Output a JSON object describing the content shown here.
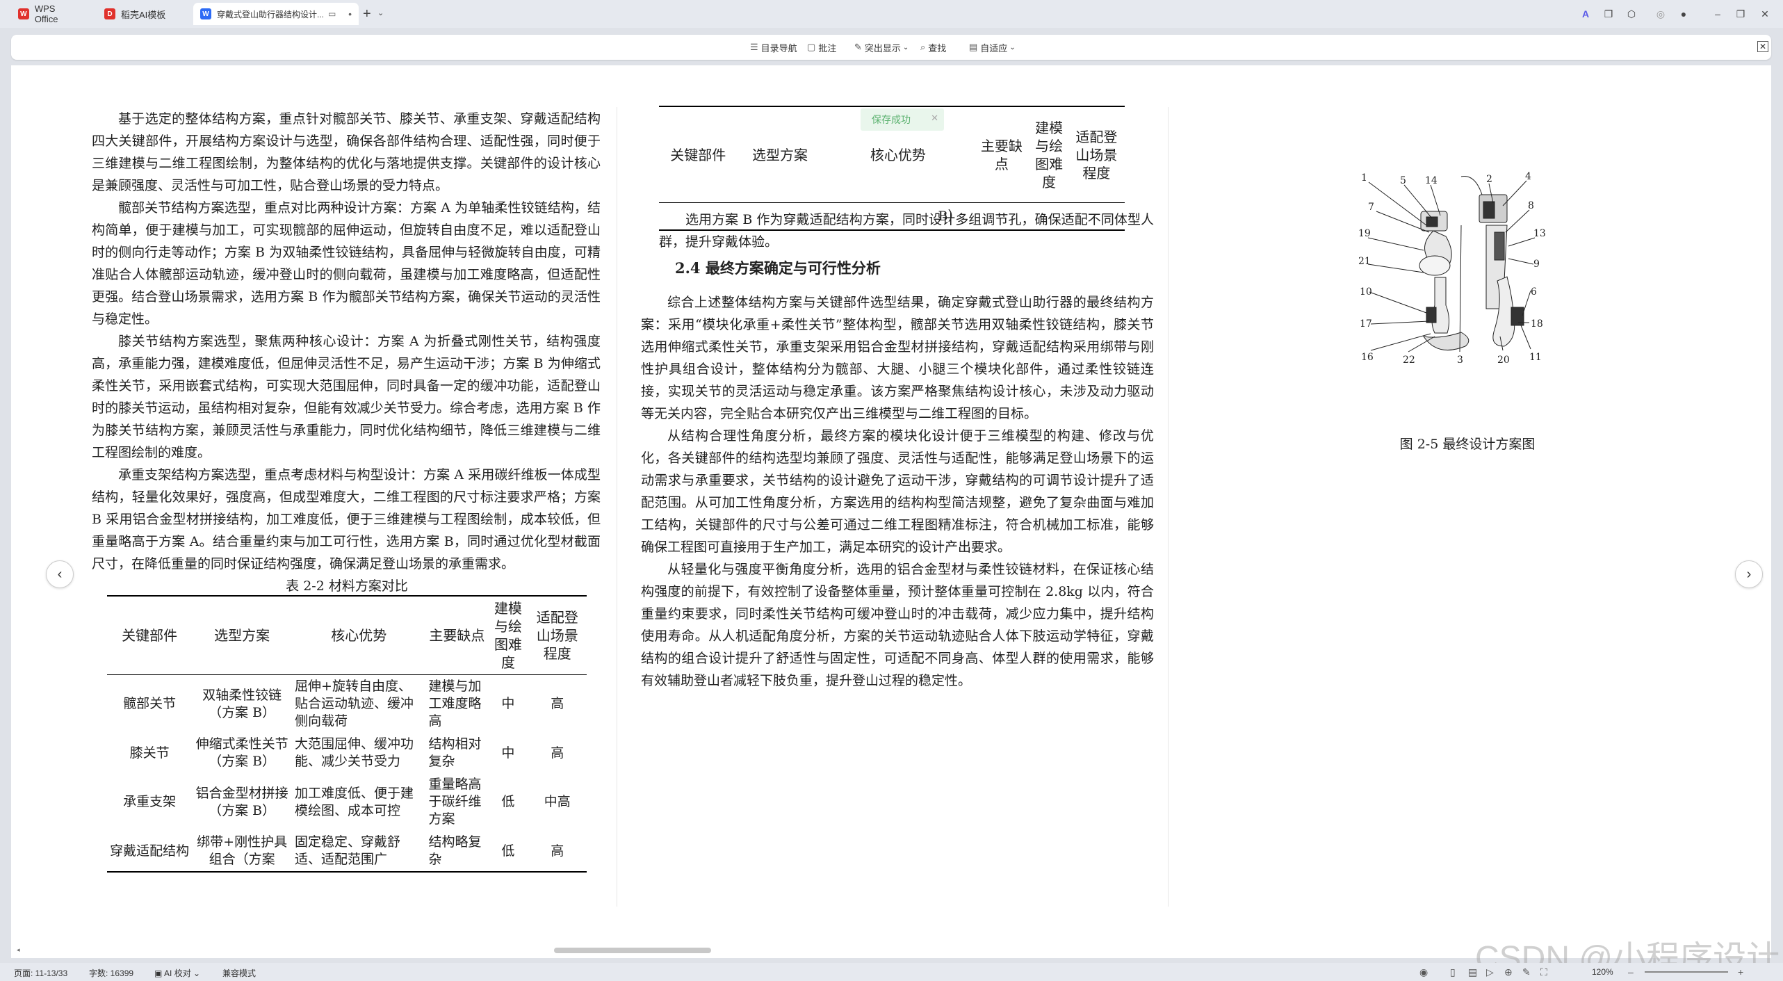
{
  "tabs": [
    {
      "label": "WPS Office",
      "icon": "wps-logo-icon",
      "color": "#e0312c"
    },
    {
      "label": "稻壳AI模板",
      "icon": "docer-logo-icon",
      "color": "#e0312c"
    },
    {
      "label": "穿戴式登山助行器结构设计...",
      "icon": "wps-writer-icon",
      "color": "#2d6bf5"
    }
  ],
  "toolbar": {
    "nav": "目录导航",
    "comment": "批注",
    "highlight": "突出显示",
    "find": "查找",
    "fit": "自适应"
  },
  "document": {
    "left_paragraphs": [
      "基于选定的整体结构方案，重点针对髋部关节、膝关节、承重支架、穿戴适配结构四大关键部件，开展结构方案设计与选型，确保各部件结构合理、适配性强，同时便于三维建模与二维工程图绘制，为整体结构的优化与落地提供支撑。关键部件的设计核心是兼顾强度、灵活性与可加工性，贴合登山场景的受力特点。",
      "髋部关节结构方案选型，重点对比两种设计方案：方案 A 为单轴柔性铰链结构，结构简单，便于建模与加工，可实现髋部的屈伸运动，但旋转自由度不足，难以适配登山时的侧向行走等动作；方案 B 为双轴柔性铰链结构，具备屈伸与轻微旋转自由度，可精准贴合人体髋部运动轨迹，缓冲登山时的侧向载荷，虽建模与加工难度略高，但适配性更强。结合登山场景需求，选用方案 B 作为髋部关节结构方案，确保关节运动的灵活性与稳定性。",
      "膝关节结构方案选型，聚焦两种核心设计：方案 A 为折叠式刚性关节，结构强度高，承重能力强，建模难度低，但屈伸灵活性不足，易产生运动干涉；方案 B 为伸缩式柔性关节，采用嵌套式结构，可实现大范围屈伸，同时具备一定的缓冲功能，适配登山时的膝关节运动，虽结构相对复杂，但能有效减少关节受力。综合考虑，选用方案 B 作为膝关节结构方案，兼顾灵活性与承重能力，同时优化结构细节，降低三维建模与二维工程图绘制的难度。",
      "承重支架结构方案选型，重点考虑材料与构型设计：方案 A 采用碳纤维板一体成型结构，轻量化效果好，强度高，但成型难度大，二维工程图的尺寸标注要求严格；方案 B 采用铝合金型材拼接结构，加工难度低，便于三维建模与工程图绘制，成本较低，但重量略高于方案 A。结合重量约束与加工可行性，选用方案 B，同时通过优化型材截面尺寸，在降低重量的同时保证结构强度，确保满足登山场景的承重需求。"
    ],
    "table1": {
      "caption": "表 2-2  材料方案对比",
      "headers": [
        "关键部件",
        "选型方案",
        "核心优势",
        "主要缺点",
        "建模与绘图难度",
        "适配登山场景程度"
      ],
      "rows": [
        [
          "髋部关节",
          "双轴柔性铰链（方案 B）",
          "屈伸+旋转自由度、贴合运动轨迹、缓冲侧向载荷",
          "建模与加工难度略高",
          "中",
          "高"
        ],
        [
          "膝关节",
          "伸缩式柔性关节（方案 B）",
          "大范围屈伸、缓冲功能、减少关节受力",
          "结构相对复杂",
          "中",
          "高"
        ],
        [
          "承重支架",
          "铝合金型材拼接（方案 B）",
          "加工难度低、便于建模绘图、成本可控",
          "重量略高于碳纤维方案",
          "低",
          "中高"
        ],
        [
          "穿戴适配结构",
          "绑带+刚性护具组合（方案",
          "固定稳定、穿戴舒适、适配范围广",
          "结构略复杂",
          "低",
          "高"
        ]
      ]
    },
    "table2": {
      "headers": [
        "关键部件",
        "选型方案",
        "核心优势",
        "主要缺点",
        "建模与绘图难度",
        "适配登山场景程度"
      ],
      "tail": "B）"
    },
    "mid_para_top": "选用方案 B 作为穿戴适配结构方案，同时设计多组调节孔，确保适配不同体型人群，提升穿戴体验。",
    "section_title": "2.4  最终方案确定与可行性分析",
    "mid_paragraphs": [
      "综合上述整体结构方案与关键部件选型结果，确定穿戴式登山助行器的最终结构方案：采用“模块化承重+柔性关节”整体构型，髋部关节选用双轴柔性铰链结构，膝关节选用伸缩式柔性关节，承重支架采用铝合金型材拼接结构，穿戴适配结构采用绑带与刚性护具组合设计，整体结构分为髋部、大腿、小腿三个模块化部件，通过柔性铰链连接，实现关节的灵活运动与稳定承重。该方案严格聚焦结构设计核心，未涉及动力驱动等无关内容，完全贴合本研究仅产出三维模型与二维工程图的目标。",
      "从结构合理性角度分析，最终方案的模块化设计便于三维模型的构建、修改与优化，各关键部件的结构选型均兼顾了强度、灵活性与适配性，能够满足登山场景下的运动需求与承重要求，关节结构的设计避免了运动干涉，穿戴结构的可调节设计提升了适配范围。从可加工性角度分析，方案选用的结构构型简洁规整，避免了复杂曲面与难加工结构，关键部件的尺寸与公差可通过二维工程图精准标注，符合机械加工标准，能够确保工程图可直接用于生产加工，满足本研究的设计产出要求。",
      "从轻量化与强度平衡角度分析，选用的铝合金型材与柔性铰链材料，在保证核心结构强度的前提下，有效控制了设备整体重量，预计整体重量可控制在 2.8kg 以内，符合重量约束要求，同时柔性关节结构可缓冲登山时的冲击载荷，减少应力集中，提升结构使用寿命。从人机适配角度分析，方案的关节运动轨迹贴合人体下肢运动学特征，穿戴结构的组合设计提升了舒适性与固定性，可适配不同身高、体型人群的使用需求，能够有效辅助登山者减轻下肢负重，提升登山过程的稳定性。"
    ],
    "toast": "保存成功",
    "figure_caption": "图 2-5  最终设计方案图",
    "figure_labels": [
      "1",
      "5",
      "14",
      "2",
      "4",
      "7",
      "8",
      "19",
      "13",
      "9",
      "21",
      "10",
      "6",
      "17",
      "18",
      "16",
      "22",
      "3",
      "20",
      "11"
    ]
  },
  "statusbar": {
    "pages": "页面: 11-13/33",
    "words": "字数: 16399",
    "ai": "AI 校对",
    "compat": "兼容模式",
    "zoom": "120%"
  },
  "watermark": "CSDN @小程序设计"
}
